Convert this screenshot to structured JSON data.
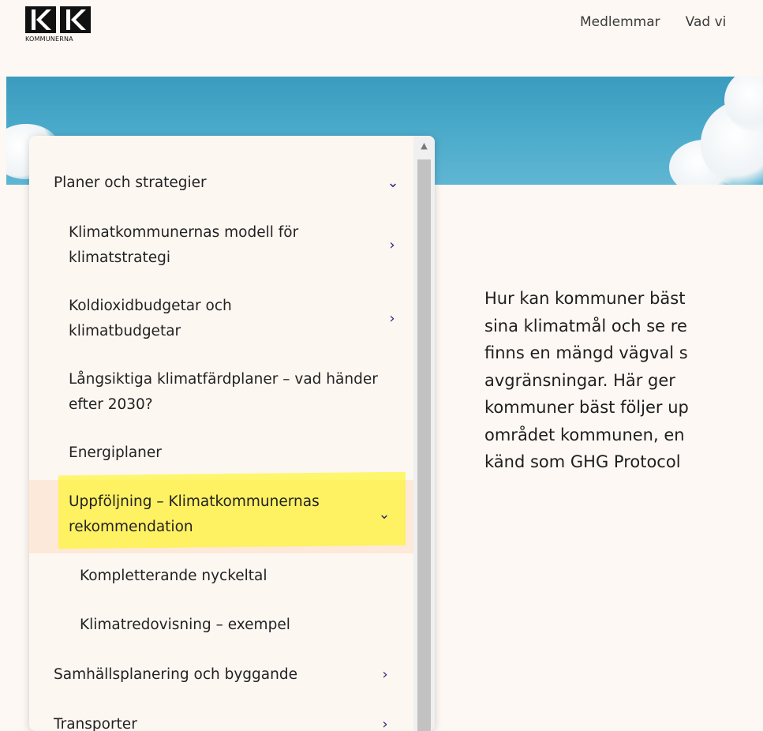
{
  "logo": {
    "text": "KOMMUNERNA"
  },
  "topnav": {
    "items": [
      "Medlemmar",
      "Vad vi"
    ]
  },
  "menu": {
    "items": [
      {
        "label": "Planer och strategier",
        "chevron": "chevron-down-icon"
      },
      {
        "label": "Klimatkommunernas modell för klimatstrategi",
        "chevron": "chevron-right-icon"
      },
      {
        "label": "Koldioxidbudgetar och klimatbudgetar",
        "chevron": "chevron-right-icon"
      },
      {
        "label": "Långsiktiga klimatfärdplaner – vad händer efter 2030?",
        "chevron": ""
      },
      {
        "label": "Energiplaner",
        "chevron": ""
      },
      {
        "label": "Uppföljning – Klimatkommunernas rekommendation",
        "chevron": "chevron-down-icon"
      },
      {
        "label": "Kompletterande nyckeltal",
        "chevron": ""
      },
      {
        "label": "Klimatredovisning – exempel",
        "chevron": ""
      },
      {
        "label": "Samhällsplanering och byggande",
        "chevron": "chevron-right-icon"
      },
      {
        "label": "Transporter",
        "chevron": "chevron-right-icon"
      }
    ],
    "highlight_color": "#fff700",
    "active_color": "#fde9d9"
  },
  "intro": {
    "lines": [
      "Hur kan kommuner bäst",
      "sina klimatmål och se re",
      "finns en mängd vägval s",
      "avgränsningar. Här ger",
      "kommuner bäst följer up",
      "området kommunen, en",
      "känd som GHG Protocol"
    ]
  },
  "colors": {
    "accent": "#2b2a7a",
    "background": "#fdf8f3"
  }
}
